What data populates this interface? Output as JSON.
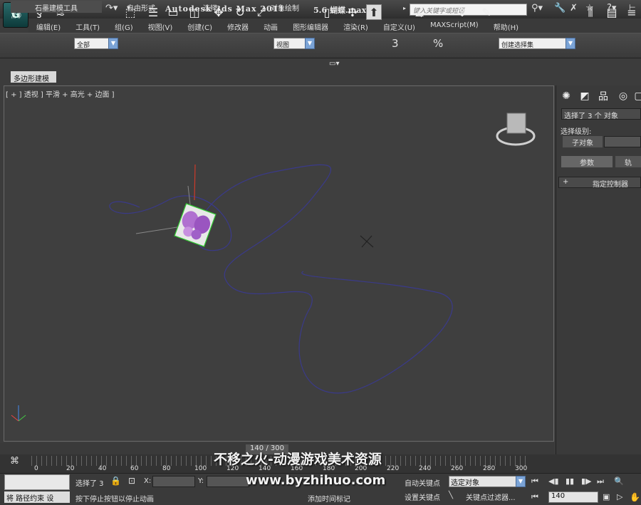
{
  "window": {
    "app_title": "Autodesk 3ds Max  2011",
    "file_title": "5.6 蝴蝶.max",
    "search_placeholder": "键入关键字或短语"
  },
  "menu": [
    "编辑(E)",
    "工具(T)",
    "组(G)",
    "视图(V)",
    "创建(C)",
    "修改器",
    "动画",
    "图形编辑器",
    "渲染(R)",
    "自定义(U)",
    "MAXScript(M)",
    "帮助(H)"
  ],
  "toolbar": {
    "selection_filter": "全部",
    "ref_coord": "视图",
    "named_selection": "创建选择集",
    "snap_labels": [
      "3",
      "%"
    ]
  },
  "ribbon": {
    "tabs": [
      "石墨建模工具",
      "自由形式",
      "选择",
      "对象绘制"
    ],
    "subtab": "多边形建模"
  },
  "viewport": {
    "label": "[ + ] 透视 ] 平滑 + 高光 + 边面 ]"
  },
  "command_panel": {
    "selection": "选择了 3 个 对象",
    "selection_level": "选择级别:",
    "sub_object": "子对象",
    "params_tab": "参数",
    "motion_tab": "轨",
    "assign_controller": "指定控制器",
    "plus": "+"
  },
  "timeline": {
    "frame": "140 / 300",
    "ticks": [
      "0",
      "20",
      "40",
      "60",
      "80",
      "100",
      "120",
      "140",
      "160",
      "180",
      "200",
      "220",
      "240",
      "260",
      "280",
      "300"
    ]
  },
  "status": {
    "selected_count": "选择了 3",
    "x_label": "X:",
    "y_label": "Y:",
    "prompt": "按下停止按钮以停止动画",
    "mini": "将 路径约束 设",
    "auto_key": "自动关键点",
    "set_key": "设置关键点",
    "selected_object": "选定对象",
    "key_filters": "关键点过滤器...",
    "add_time_tag": "添加时间标记",
    "current_frame": "140"
  },
  "watermark": {
    "line1": "不移之火-动漫游戏美术资源",
    "line2": "www.byzhihuo.com"
  },
  "colors": {
    "path": "#3a3a8a",
    "gizmo": "#33cc33",
    "butterfly": "#b070d0"
  }
}
